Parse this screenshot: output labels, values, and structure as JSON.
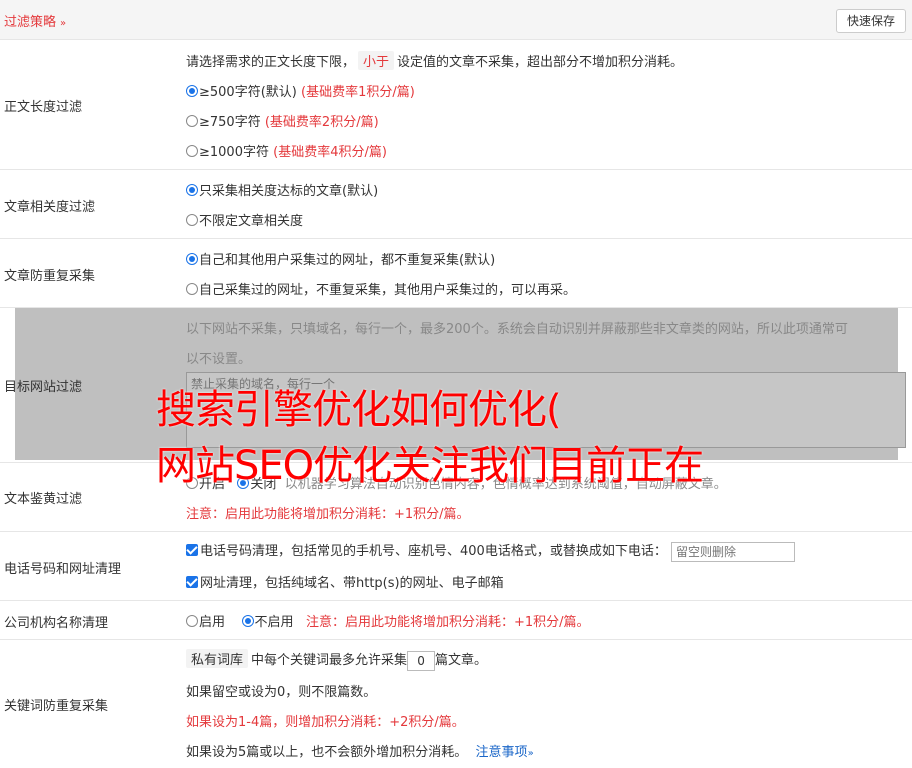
{
  "header": {
    "title": "过滤策略",
    "chevron": "»",
    "save_label": "快速保存"
  },
  "length_filter": {
    "label": "正文长度过滤",
    "desc_before": "请选择需求的正文长度下限，",
    "desc_tag": "小于",
    "desc_after": "设定值的文章不采集，超出部分不增加积分消耗。",
    "options": [
      {
        "text": "≥500字符(默认)",
        "note": "(基础费率1积分/篇)",
        "checked": true
      },
      {
        "text": "≥750字符",
        "note": "(基础费率2积分/篇)",
        "checked": false
      },
      {
        "text": "≥1000字符",
        "note": "(基础费率4积分/篇)",
        "checked": false
      }
    ]
  },
  "relevance_filter": {
    "label": "文章相关度过滤",
    "options": [
      {
        "text": "只采集相关度达标的文章(默认)",
        "checked": true
      },
      {
        "text": "不限定文章相关度",
        "checked": false
      }
    ]
  },
  "dup_filter": {
    "label": "文章防重复采集",
    "options": [
      {
        "text": "自己和其他用户采集过的网址，都不重复采集(默认)",
        "checked": true
      },
      {
        "text": "自己采集过的网址，不重复采集，其他用户采集过的，可以再采。",
        "checked": false
      }
    ]
  },
  "site_filter": {
    "label": "目标网站过滤",
    "desc_line1": "以下网站不采集，只填域名，每行一个，最多200个。系统会自动识别并屏蔽那些非文章类的网站，所以此项通常可",
    "desc_line2": "以不设置。",
    "placeholder": "禁止采集的域名，每行一个"
  },
  "porn_filter": {
    "label": "文本鉴黄过滤",
    "on_label": "开启",
    "off_label": "关闭",
    "desc": "以机器学习算法自动识别色情内容，色情概率达到系统阈值，自动屏蔽文章。",
    "note": "注意：启用此功能将增加积分消耗：+1积分/篇。"
  },
  "phone_filter": {
    "label": "电话号码和网址清理",
    "phone_text": "电话号码清理，包括常见的手机号、座机号、400电话格式，或替换成如下电话：",
    "phone_placeholder": "留空则删除",
    "url_text": "网址清理，包括纯域名、带http(s)的网址、电子邮箱"
  },
  "company_filter": {
    "label": "公司机构名称清理",
    "on_label": "启用",
    "off_label": "不启用",
    "note": "注意：启用此功能将增加积分消耗：+1积分/篇。"
  },
  "keyword_filter": {
    "label": "关键词防重复采集",
    "tag": "私有词库",
    "line1_mid": "中每个关键词最多允许采集",
    "value": "0",
    "line1_end": "篇文章。",
    "line2": "如果留空或设为0，则不限篇数。",
    "line3": "如果设为1-4篇，则增加积分消耗：+2积分/篇。",
    "line4": "如果设为5篇或以上，也不会额外增加积分消耗。",
    "notice_link": "注意事项",
    "notice_chevron": "»"
  },
  "watermark": {
    "line1": "搜索引擎优化如何优化(",
    "line2": "网站SEO优化关注我们目前正在"
  },
  "colors": {
    "accent_red": "#e4393c",
    "radio_blue": "#1a73e8",
    "link_blue": "#1a66c8",
    "watermark_red": "#ff0000"
  }
}
